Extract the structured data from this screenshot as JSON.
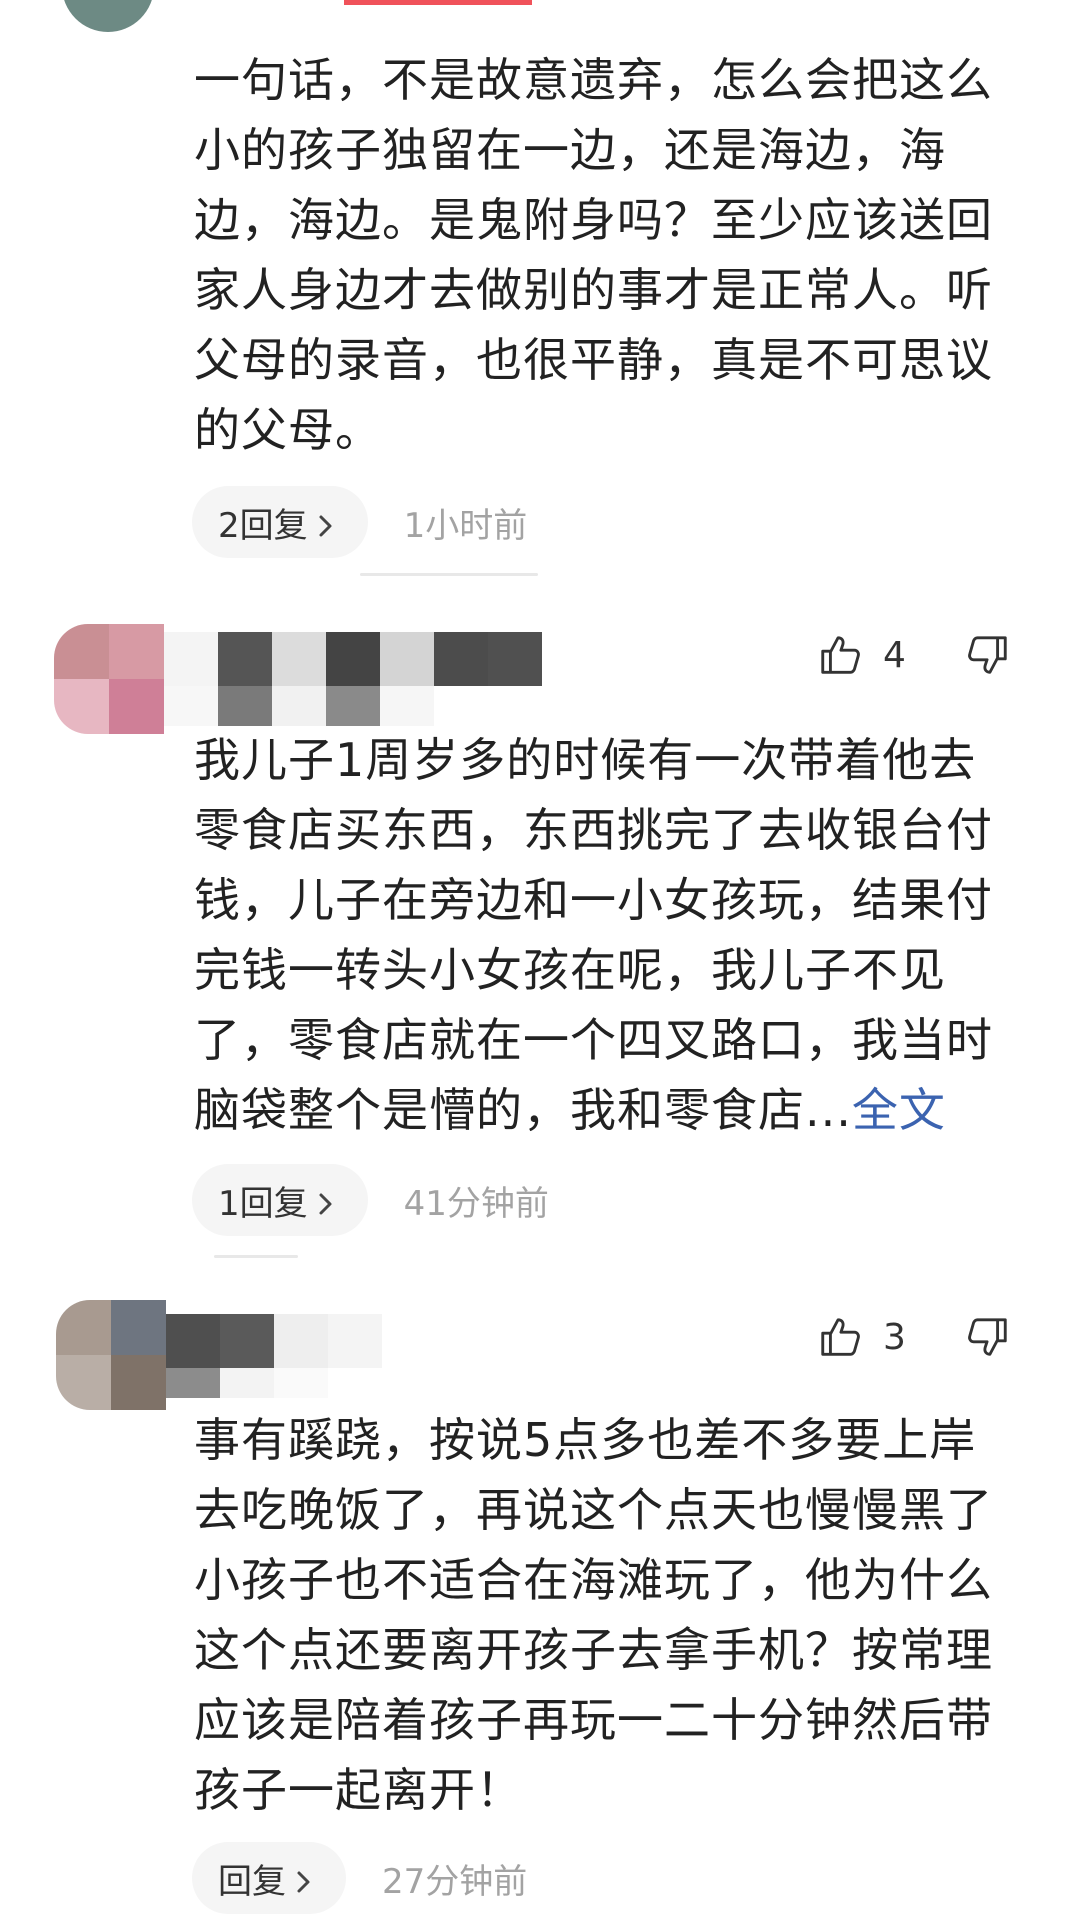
{
  "comments": [
    {
      "text": "一句话，不是故意遗弃，怎么会把这么\n小的孩子独留在一边，还是海边，海\n边，海边。是鬼附身吗？至少应该送回\n家人身边才去做别的事才是正常人。听\n父母的录音，也很平静，真是不可思议\n的父母。",
      "reply_label": "2回复",
      "timestamp": "1小时前"
    },
    {
      "likes": "4",
      "text": "我儿子1周岁多的时候有一次带着他去\n零食店买东西，东西挑完了去收银台付\n钱，儿子在旁边和一小女孩玩，结果付\n完钱一转头小女孩在呢，我儿子不见\n了，零食店就在一个四叉路口，我当时\n脑袋整个是懵的，我和零食店...",
      "full_text_link": "全文",
      "reply_label": "1回复",
      "timestamp": "41分钟前"
    },
    {
      "likes": "3",
      "text": "事有蹊跷，按说5点多也差不多要上岸\n去吃晚饭了，再说这个点天也慢慢黑了\n小孩子也不适合在海滩玩了，他为什么\n这个点还要离开孩子去拿手机？按常理\n应该是陪着孩子再玩一二十分钟然后带\n孩子一起离开！",
      "reply_label": "回复",
      "timestamp": "27分钟前"
    }
  ],
  "icons": {
    "like": "thumbs-up-outline-icon",
    "dislike": "thumbs-down-outline-icon",
    "reply_chevron": "chevron-right-icon"
  },
  "colors": {
    "accent": "#f0525a",
    "link": "#3b63b0",
    "meta_text": "#a3a3a3",
    "pill_bg": "#f5f5f5"
  }
}
